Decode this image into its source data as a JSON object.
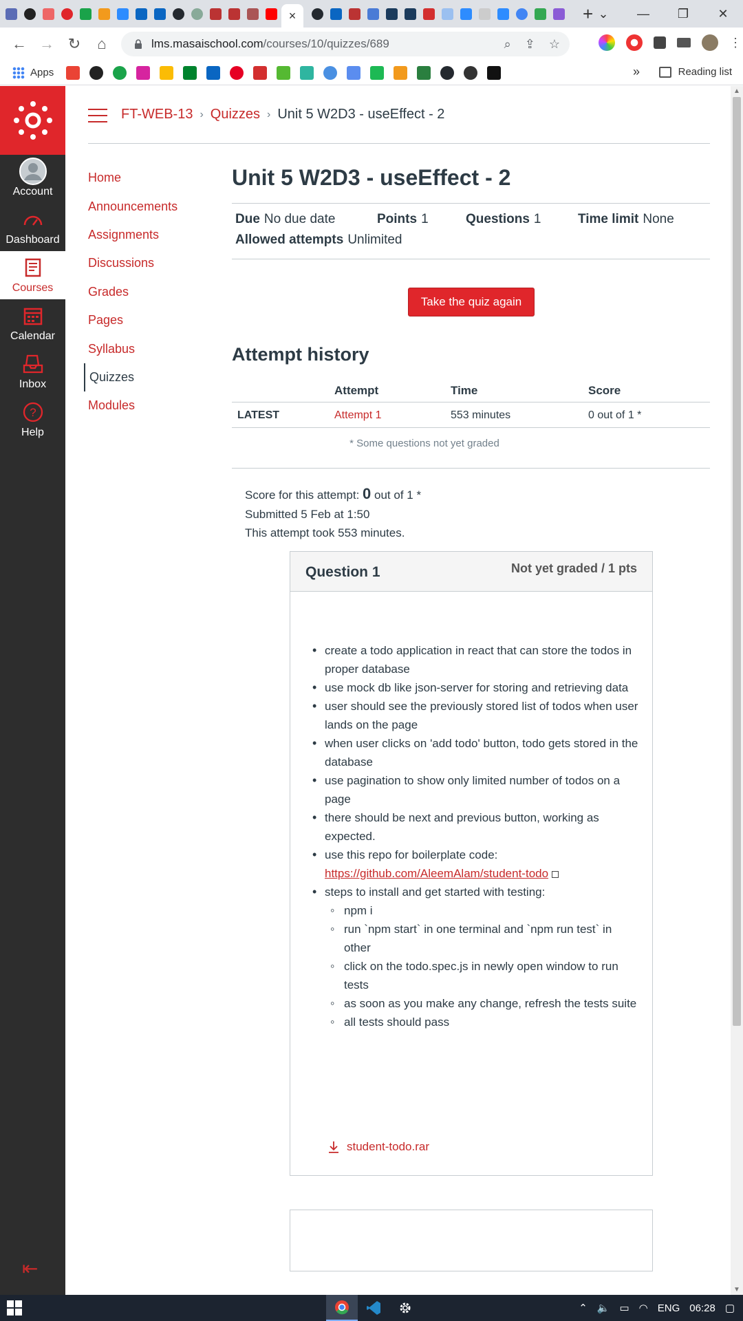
{
  "browser": {
    "url_host": "lms.masaischool.com",
    "url_path": "/courses/10/quizzes/689",
    "bookmarks_apps_label": "Apps",
    "reading_list_label": "Reading list",
    "overflow_label": "»",
    "new_tab_label": "+",
    "close_tab_label": "×"
  },
  "global_nav": {
    "items": [
      {
        "label": "Account",
        "icon": "user-avatar-icon"
      },
      {
        "label": "Dashboard",
        "icon": "dashboard-gauge-icon"
      },
      {
        "label": "Courses",
        "icon": "courses-book-icon"
      },
      {
        "label": "Calendar",
        "icon": "calendar-icon"
      },
      {
        "label": "Inbox",
        "icon": "inbox-icon"
      },
      {
        "label": "Help",
        "icon": "help-question-icon"
      }
    ],
    "active": "Courses",
    "accent": "#e0262b"
  },
  "breadcrumb": {
    "course": "FT-WEB-13",
    "section": "Quizzes",
    "current": "Unit 5 W2D3 - useEffect - 2",
    "separator": "›"
  },
  "course_nav": {
    "items": [
      "Home",
      "Announcements",
      "Assignments",
      "Discussions",
      "Grades",
      "Pages",
      "Syllabus",
      "Quizzes",
      "Modules"
    ],
    "active": "Quizzes"
  },
  "quiz": {
    "title": "Unit 5 W2D3 - useEffect - 2",
    "due_label": "Due",
    "due_value": "No due date",
    "points_label": "Points",
    "points_value": "1",
    "questions_label": "Questions",
    "questions_value": "1",
    "time_limit_label": "Time limit",
    "time_limit_value": "None",
    "attempts_label": "Allowed attempts",
    "attempts_value": "Unlimited",
    "take_again_label": "Take the quiz again"
  },
  "attempt_history": {
    "heading": "Attempt history",
    "columns": [
      "",
      "Attempt",
      "Time",
      "Score"
    ],
    "rows": [
      {
        "tag": "LATEST",
        "attempt": "Attempt 1",
        "time": "553 minutes",
        "score": "0 out of 1 *"
      }
    ],
    "note": "* Some questions not yet graded"
  },
  "attempt_summary": {
    "score_prefix": "Score for this attempt:",
    "score_value": "0",
    "score_suffix": "out of 1 *",
    "submitted": "Submitted 5 Feb at 1:50",
    "duration": "This attempt took 553 minutes."
  },
  "question": {
    "title": "Question 1",
    "status": "Not yet graded / 1 pts",
    "bullets": [
      "create a todo application in react that can store the todos in proper database",
      "use mock db like json-server for storing and retrieving data",
      "user should see the previously stored list of todos when user lands on the page",
      "when user clicks on 'add todo' button, todo gets stored in the database",
      "use pagination to show only limited number of todos on a page",
      "there should be next and previous button, working as expected."
    ],
    "repo_prefix": "use this repo for boilerplate code:",
    "repo_link": "https://github.com/AleemAlam/student-todo",
    "steps_label": "steps to install and get started with testing:",
    "steps": [
      "npm i",
      "run `npm start` in one terminal and `npm run test` in other",
      "click on the todo.spec.js in newly open window to run tests",
      "as soon as you make any change, refresh the tests suite",
      "all tests should pass"
    ],
    "attachment": "student-todo.rar"
  },
  "taskbar": {
    "language": "ENG",
    "time": "06:28"
  }
}
